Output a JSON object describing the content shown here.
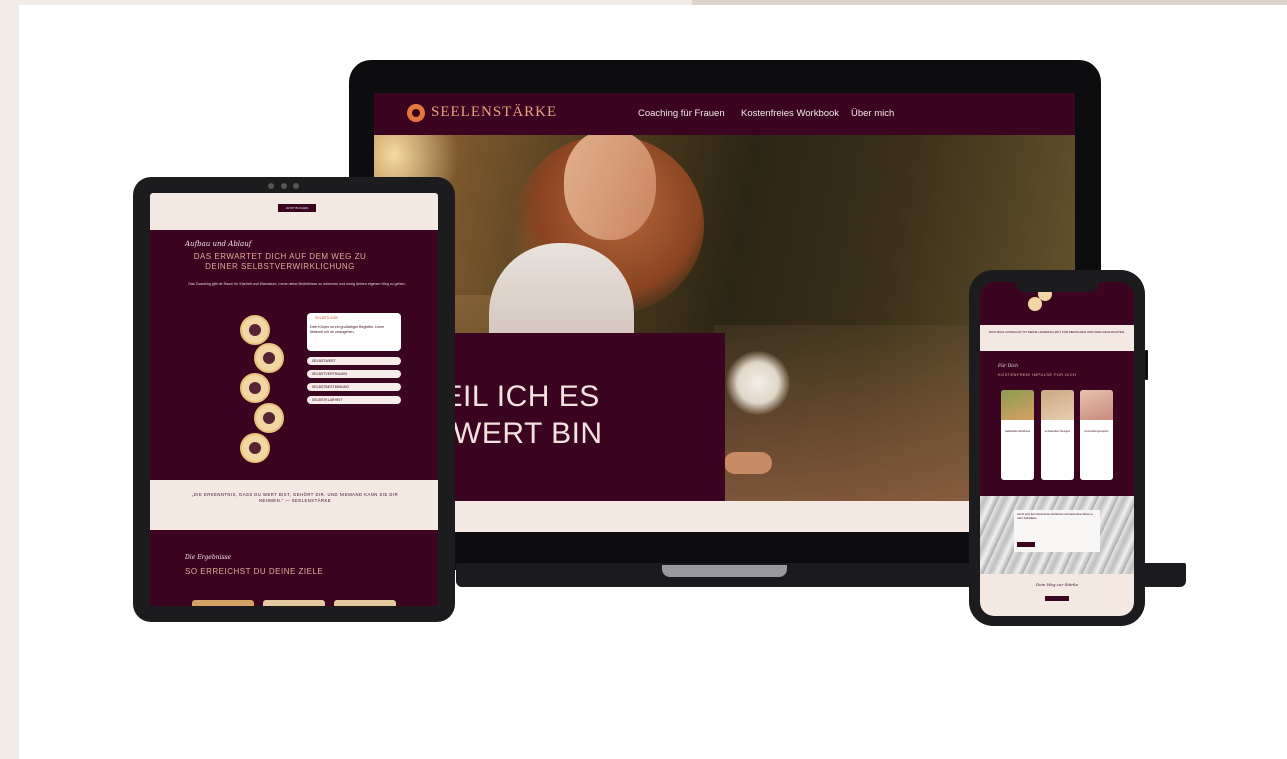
{
  "laptop": {
    "brand": "SEELENSTÄRKE",
    "nav": [
      "Coaching für Frauen",
      "Kostenfreies Workbook",
      "Über mich"
    ],
    "headline_line1": "VEIL ICH ES",
    "headline_line2": "R WERT BIN"
  },
  "colors": {
    "burgundy": "#3b0522",
    "cream": "#f3e8e2",
    "accent": "#e6a994",
    "gold": "#f0d7a4"
  },
  "tablet": {
    "top_button": "JETZT BUCHEN",
    "script_title": "Aufbau und Ablauf",
    "heading": "DAS ERWARTET DICH AUF DEM WEG ZU DEINER SELBSTVERWIRKLICHUNG",
    "paragraph": "Das Coaching gibt dir Raum für Klarheit und Wachstum. Lerne deine Bedürfnisse zu erkennen und mutig deinen eigenen Weg zu gehen.",
    "card_heading": "SELBSTLIEBE",
    "card_text": "Dein Körper ist ein großartiger Begleiter. Lerne liebevoll mit dir umzugehen.",
    "list_items": [
      "SELBSTWERT",
      "SELBSTVERTRAUEN",
      "SELBSTBESTIMMUNG",
      "SELBSTKLARHEIT"
    ],
    "quote": "„DIE ERKENNTNIS, DASS DU WERT BIST, GEHÖRT DIR. UND NIEMAND KANN SIE DIR NEHMEN.\" — SEELENSTÄRKE",
    "script_title2": "Die Ergebnisse",
    "heading2": "SO ERREICHST DU DEINE ZIELE"
  },
  "phone": {
    "band_text": "WAS MICH AUSMACHT IST MEINE LEIDENSCHAFT FÜR MENSCHEN UND IHRE GESCHICHTEN.",
    "script_title": "Für Dich",
    "heading": "KOSTENFREIE IMPULSE FÜR DICH",
    "cards": [
      "Selbstliebe Workbook",
      "Achtsamkeit Übungen",
      "Kennenlerngespräch"
    ],
    "fabric_text": "Hol dir jetzt dein kostenfreies Workbook und starte deine Reise zu mehr Selbstliebe.",
    "bottom_script": "Dein Weg zur Stärke"
  }
}
